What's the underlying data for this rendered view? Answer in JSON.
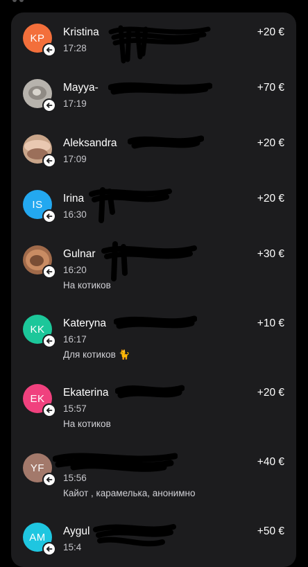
{
  "transactions": [
    {
      "initials": "KP",
      "avatar_color": "#f36f3b",
      "avatar_type": "initials",
      "name": "Kristina",
      "time": "17:28",
      "note": "",
      "amount": "+20 €"
    },
    {
      "initials": "",
      "avatar_color": "#b7b3ad",
      "avatar_type": "photo",
      "name": "Mayya-",
      "time": "17:19",
      "note": "",
      "amount": "+70 €"
    },
    {
      "initials": "",
      "avatar_color": "#c9a58a",
      "avatar_type": "photo",
      "name": "Aleksandra",
      "time": "17:09",
      "note": "",
      "amount": "+20 €"
    },
    {
      "initials": "IS",
      "avatar_color": "#23a8f0",
      "avatar_type": "initials",
      "name": "Irina",
      "time": "16:30",
      "note": "",
      "amount": "+20 €"
    },
    {
      "initials": "",
      "avatar_color": "#a06a4a",
      "avatar_type": "photo",
      "name": "Gulnar",
      "time": "16:20",
      "note": "На котиков",
      "amount": "+30 €"
    },
    {
      "initials": "KK",
      "avatar_color": "#1cc79a",
      "avatar_type": "initials",
      "name": "Kateryna",
      "time": "16:17",
      "note": "Для котиков 🐈",
      "amount": "+10 €"
    },
    {
      "initials": "EK",
      "avatar_color": "#f0417e",
      "avatar_type": "initials",
      "name": "Ekaterina",
      "time": "15:57",
      "note": "На котиков",
      "amount": "+20 €"
    },
    {
      "initials": "YF",
      "avatar_color": "#a3796b",
      "avatar_type": "initials",
      "name": "",
      "time": "15:56",
      "note": "Кайот , карамелька, анонимно",
      "amount": "+40 €"
    },
    {
      "initials": "AM",
      "avatar_color": "#1fc6e0",
      "avatar_type": "initials",
      "name": "Aygul",
      "time": "15:4",
      "note": "",
      "amount": "+50 €"
    }
  ],
  "icons": {
    "incoming": "arrow-left-icon"
  }
}
